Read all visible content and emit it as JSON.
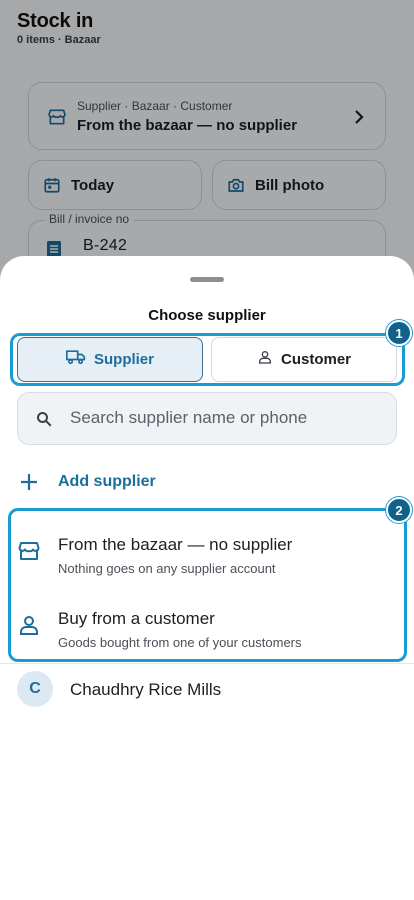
{
  "page": {
    "title": "Stock in",
    "subtitle": "0 items · Bazaar"
  },
  "supplier_card": {
    "overline": "Supplier · Bazaar · Customer",
    "value": "From the bazaar — no supplier",
    "icon": "store-icon",
    "chevron": "chevron-right-icon"
  },
  "date_pill": {
    "label": "Today",
    "icon": "calendar-icon"
  },
  "photo_pill": {
    "label": "Bill photo",
    "icon": "camera-icon"
  },
  "bill_field": {
    "label": "Bill / invoice no",
    "value": "B-242",
    "icon": "receipt-icon"
  },
  "sheet": {
    "title": "Choose supplier",
    "tabs": [
      {
        "label": "Supplier",
        "icon": "truck-icon",
        "selected": true
      },
      {
        "label": "Customer",
        "icon": "person-icon",
        "selected": false
      }
    ],
    "search": {
      "placeholder": "Search supplier name or phone",
      "value": "",
      "icon": "search-icon"
    },
    "add_label": "Add supplier",
    "options": [
      {
        "title": "From the bazaar — no supplier",
        "subtitle": "Nothing goes on any supplier account",
        "icon": "store-icon"
      },
      {
        "title": "Buy from a customer",
        "subtitle": "Goods bought from one of your customers",
        "icon": "person-icon"
      }
    ],
    "suppliers": [
      {
        "initial": "C",
        "name": "Chaudhry Rice Mills"
      }
    ]
  },
  "annotations": {
    "markers": [
      "1",
      "2"
    ],
    "highlight_color": "#1a9bd4",
    "marker_color": "#11628a"
  },
  "colors": {
    "accent": "#1c6e9b",
    "selected_tab_bg": "#e6eff5",
    "scrim": "rgba(0,0,0,0.32)"
  }
}
